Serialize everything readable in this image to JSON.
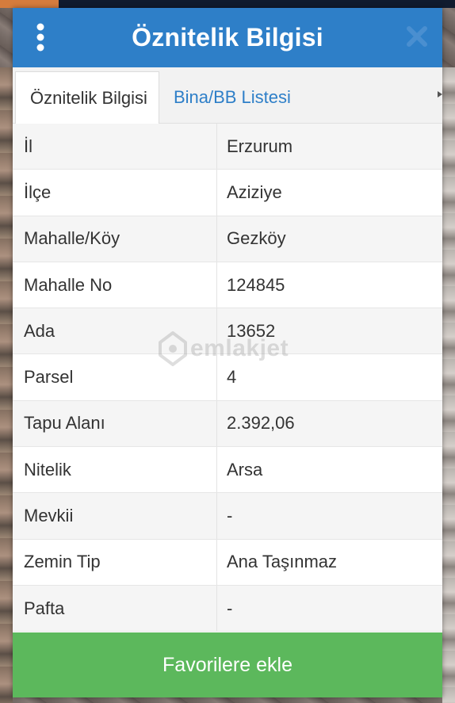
{
  "dialog": {
    "title": "Öznitelik Bilgisi"
  },
  "tabs": [
    {
      "label": "Öznitelik Bilgisi",
      "active": true
    },
    {
      "label": "Bina/BB Listesi",
      "active": false
    }
  ],
  "attributes": [
    {
      "label": "İl",
      "value": "Erzurum"
    },
    {
      "label": "İlçe",
      "value": "Aziziye"
    },
    {
      "label": "Mahalle/Köy",
      "value": "Gezköy"
    },
    {
      "label": "Mahalle No",
      "value": "124845"
    },
    {
      "label": "Ada",
      "value": "13652"
    },
    {
      "label": "Parsel",
      "value": "4"
    },
    {
      "label": "Tapu Alanı",
      "value": "2.392,06"
    },
    {
      "label": "Nitelik",
      "value": "Arsa"
    },
    {
      "label": "Mevkii",
      "value": "-"
    },
    {
      "label": "Zemin Tip",
      "value": "Ana Taşınmaz"
    },
    {
      "label": "Pafta",
      "value": "-"
    }
  ],
  "actions": {
    "favorite_label": "Favorilere ekle"
  },
  "watermark": {
    "text": "emlakjet"
  },
  "colors": {
    "header": "#2e7fc8",
    "tab_active_text": "#333333",
    "tab_inactive_text": "#2e7fc8",
    "favorite_button": "#5cb85c"
  },
  "icons": {
    "menu": "more-vertical-icon",
    "close": "close-icon",
    "watermark": "home-pin-icon"
  }
}
